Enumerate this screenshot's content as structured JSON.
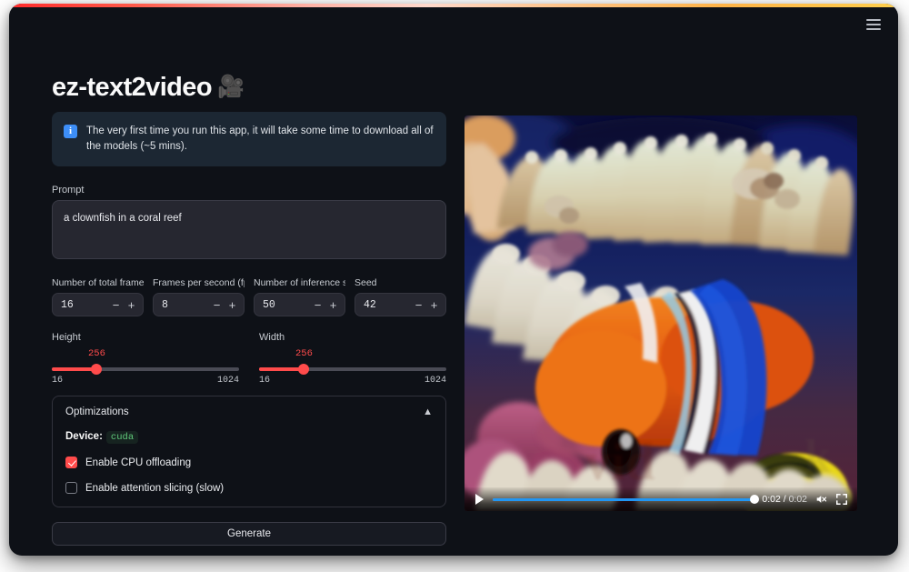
{
  "window": {
    "accent_bar": "gradient-red-to-yellow",
    "menu_icon": "hamburger-icon",
    "background": "#0e1117"
  },
  "header": {
    "title": "ez-text2video",
    "title_emoji": "🎥"
  },
  "info_banner": {
    "icon": "info-icon",
    "icon_glyph": "i",
    "text": "The very first time you run this app, it will take some time to download all of the models (~5 mins).",
    "background": "#1c2733",
    "icon_color": "#3d8ef7"
  },
  "prompt": {
    "label": "Prompt",
    "value": "a clownfish in a coral reef",
    "placeholder": ""
  },
  "number_inputs": [
    {
      "label": "Number of total frames",
      "value": "16",
      "decrement": "−",
      "increment": "+"
    },
    {
      "label": "Frames per second (fps)",
      "value": "8",
      "decrement": "−",
      "increment": "+"
    },
    {
      "label": "Number of inference steps",
      "value": "50",
      "decrement": "−",
      "increment": "+"
    },
    {
      "label": "Seed",
      "value": "42",
      "decrement": "−",
      "increment": "+"
    }
  ],
  "sliders": [
    {
      "label": "Height",
      "value": "256",
      "min": "16",
      "max": "1024",
      "percent": 24,
      "accent": "#ff4b4b"
    },
    {
      "label": "Width",
      "value": "256",
      "min": "16",
      "max": "1024",
      "percent": 24,
      "accent": "#ff4b4b"
    }
  ],
  "optimizations": {
    "title": "Optimizations",
    "chevron": "▲",
    "expanded": true,
    "device_label": "Device:",
    "device_value": "cuda",
    "device_value_color": "#5fc97a",
    "checkboxes": [
      {
        "label": "Enable CPU offloading",
        "checked": true
      },
      {
        "label": "Enable attention slicing (slow)",
        "checked": false
      }
    ]
  },
  "generate": {
    "label": "Generate"
  },
  "video": {
    "alt": "generated video of a clownfish in a coral reef anemone",
    "play_icon": "play-icon",
    "mute_icon": "speaker-muted-icon",
    "fullscreen_icon": "fullscreen-icon",
    "current_time": "0:02",
    "total_time": "0:02",
    "time_separator": " / ",
    "progress_percent": 100,
    "progress_color": "#2196f3"
  }
}
